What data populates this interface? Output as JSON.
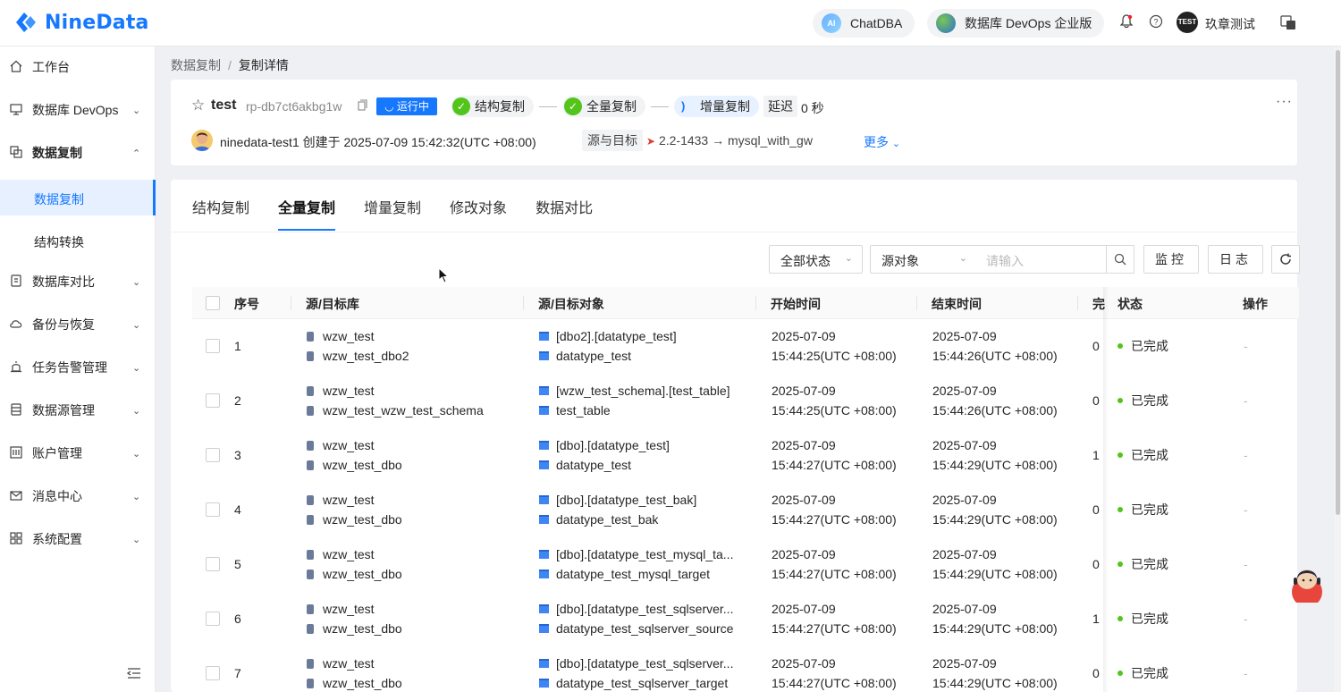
{
  "header": {
    "logo_text": "NineData",
    "chatdba_label": "ChatDBA",
    "devops_label": "数据库 DevOps 企业版",
    "user_avatar_text": "TEST",
    "user_name": "玖章测试"
  },
  "sidebar": {
    "items": [
      {
        "label": "工作台",
        "icon": "home-icon"
      },
      {
        "label": "数据库 DevOps",
        "icon": "monitor-icon"
      },
      {
        "label": "数据复制",
        "icon": "copy-icon"
      },
      {
        "label": "数据库对比",
        "icon": "compare-icon"
      },
      {
        "label": "备份与恢复",
        "icon": "cloud-icon"
      },
      {
        "label": "任务告警管理",
        "icon": "alarm-icon"
      },
      {
        "label": "数据源管理",
        "icon": "datasource-icon"
      },
      {
        "label": "账户管理",
        "icon": "account-icon"
      },
      {
        "label": "消息中心",
        "icon": "mail-icon"
      },
      {
        "label": "系统配置",
        "icon": "grid-icon"
      }
    ],
    "sub_items": [
      {
        "label": "数据复制"
      },
      {
        "label": "结构转换"
      }
    ]
  },
  "breadcrumb": {
    "parent": "数据复制",
    "separator": "/",
    "current": "复制详情"
  },
  "task": {
    "name": "test",
    "id": "rp-db7ct6akbg1w",
    "status": "运行中",
    "steps": [
      {
        "label": "结构复制",
        "state": "done"
      },
      {
        "label": "全量复制",
        "state": "done"
      },
      {
        "label": "增量复制",
        "state": "running"
      }
    ],
    "delay_label": "延迟",
    "delay_value": "0 秒",
    "creator_text": "ninedata-test1 创建于 2025-07-09 15:42:32(UTC +08:00)",
    "source_target_label": "源与目标",
    "source_target_value": "2.2-1433 → mysql_with_gw",
    "more_link": "更多"
  },
  "tabs": [
    "结构复制",
    "全量复制",
    "增量复制",
    "修改对象",
    "数据对比"
  ],
  "active_tab": "全量复制",
  "filters": {
    "status_select": "全部状态",
    "object_select": "源对象",
    "search_placeholder": "请输入",
    "monitor_button": "监控",
    "log_button": "日志"
  },
  "table": {
    "columns": [
      "序号",
      "源/目标库",
      "源/目标对象",
      "开始时间",
      "结束时间",
      "完",
      "状态",
      "操作"
    ],
    "rows": [
      {
        "no": "1",
        "src_db": "wzw_test",
        "dst_db": "wzw_test_dbo2",
        "src_obj": "[dbo2].[datatype_test]",
        "dst_obj": "datatype_test",
        "start_date": "2025-07-09",
        "start_time": "15:44:25(UTC +08:00)",
        "end_date": "2025-07-09",
        "end_time": "15:44:26(UTC +08:00)",
        "done": "0",
        "status": "已完成",
        "op": "-"
      },
      {
        "no": "2",
        "src_db": "wzw_test",
        "dst_db": "wzw_test_wzw_test_schema",
        "src_obj": "[wzw_test_schema].[test_table]",
        "dst_obj": "test_table",
        "start_date": "2025-07-09",
        "start_time": "15:44:25(UTC +08:00)",
        "end_date": "2025-07-09",
        "end_time": "15:44:26(UTC +08:00)",
        "done": "0",
        "status": "已完成",
        "op": "-"
      },
      {
        "no": "3",
        "src_db": "wzw_test",
        "dst_db": "wzw_test_dbo",
        "src_obj": "[dbo].[datatype_test]",
        "dst_obj": "datatype_test",
        "start_date": "2025-07-09",
        "start_time": "15:44:27(UTC +08:00)",
        "end_date": "2025-07-09",
        "end_time": "15:44:29(UTC +08:00)",
        "done": "1",
        "status": "已完成",
        "op": "-"
      },
      {
        "no": "4",
        "src_db": "wzw_test",
        "dst_db": "wzw_test_dbo",
        "src_obj": "[dbo].[datatype_test_bak]",
        "dst_obj": "datatype_test_bak",
        "start_date": "2025-07-09",
        "start_time": "15:44:27(UTC +08:00)",
        "end_date": "2025-07-09",
        "end_time": "15:44:29(UTC +08:00)",
        "done": "0",
        "status": "已完成",
        "op": "-"
      },
      {
        "no": "5",
        "src_db": "wzw_test",
        "dst_db": "wzw_test_dbo",
        "src_obj": "[dbo].[datatype_test_mysql_ta...",
        "dst_obj": "datatype_test_mysql_target",
        "start_date": "2025-07-09",
        "start_time": "15:44:27(UTC +08:00)",
        "end_date": "2025-07-09",
        "end_time": "15:44:29(UTC +08:00)",
        "done": "0",
        "status": "已完成",
        "op": "-"
      },
      {
        "no": "6",
        "src_db": "wzw_test",
        "dst_db": "wzw_test_dbo",
        "src_obj": "[dbo].[datatype_test_sqlserver...",
        "dst_obj": "datatype_test_sqlserver_source",
        "start_date": "2025-07-09",
        "start_time": "15:44:27(UTC +08:00)",
        "end_date": "2025-07-09",
        "end_time": "15:44:29(UTC +08:00)",
        "done": "1",
        "status": "已完成",
        "op": "-"
      },
      {
        "no": "7",
        "src_db": "wzw_test",
        "dst_db": "wzw_test_dbo",
        "src_obj": "[dbo].[datatype_test_sqlserver...",
        "dst_obj": "datatype_test_sqlserver_target",
        "start_date": "2025-07-09",
        "start_time": "15:44:27(UTC +08:00)",
        "end_date": "2025-07-09",
        "end_time": "15:44:29(UTC +08:00)",
        "done": "0",
        "status": "已完成",
        "op": "-"
      }
    ]
  },
  "colors": {
    "accent": "#1677ff",
    "success": "#52c41a"
  }
}
